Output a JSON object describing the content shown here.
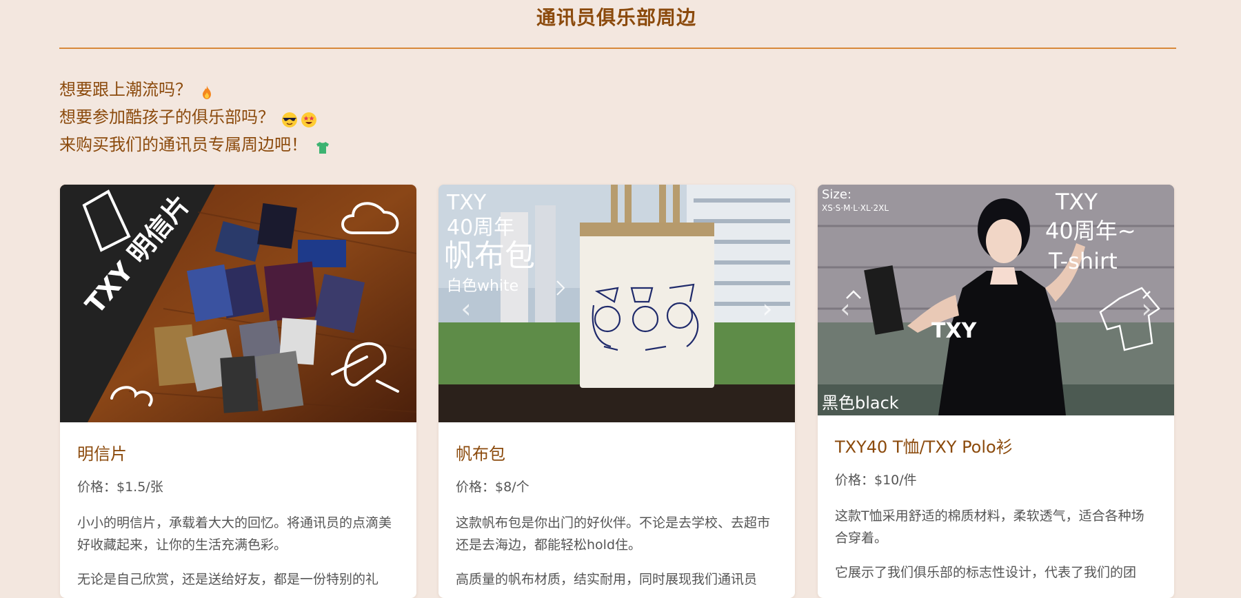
{
  "page": {
    "title": "通讯员俱乐部周边"
  },
  "intro": {
    "lines": [
      {
        "text": "想要跟上潮流吗？",
        "icons": [
          "fire-icon"
        ]
      },
      {
        "text": "想要参加酷孩子的俱乐部吗？",
        "icons": [
          "sunglasses-face-icon",
          "star-struck-face-icon"
        ]
      },
      {
        "text": "来购买我们的通讯员专属周边吧！",
        "icons": [
          "tshirt-icon"
        ]
      }
    ]
  },
  "colors": {
    "accent": "#8b4a0c",
    "rule": "#d8883a",
    "background": "#f3e7df"
  },
  "products": [
    {
      "name": "明信片",
      "price": "价格：$1.5/张",
      "desc1": "小小的明信片，承载着大大的回忆。将通讯员的点滴美好收藏起来，让你的生活充满色彩。",
      "desc2": "无论是自己欣赏，还是送给好友，都是一份特别的礼",
      "image_text": [
        "TXY 明信片"
      ]
    },
    {
      "name": "帆布包",
      "price": "价格：$8/个",
      "desc1": "这款帆布包是你出门的好伙伴。不论是去学校、去超市还是去海边，都能轻松hold住。",
      "desc2": "高质量的帆布材质，结实耐用，同时展现我们通讯员",
      "image_text": [
        "TXY",
        "40周年",
        "帆布包",
        "白色white"
      ]
    },
    {
      "name": "TXY40 T恤/TXY Polo衫",
      "price": "价格：$10/件",
      "desc1": "这款T恤采用舒适的棉质材料，柔软透气，适合各种场合穿着。",
      "desc2": "它展示了我们俱乐部的标志性设计，代表了我们的团",
      "image_text": [
        "Size:",
        "XS·S·M·L·XL·2XL",
        "TXY",
        "40周年~",
        "T-shirt",
        "黑色black",
        "TXY"
      ]
    }
  ],
  "carousel": {
    "prev_symbol": "‹",
    "next_symbol": "›"
  }
}
